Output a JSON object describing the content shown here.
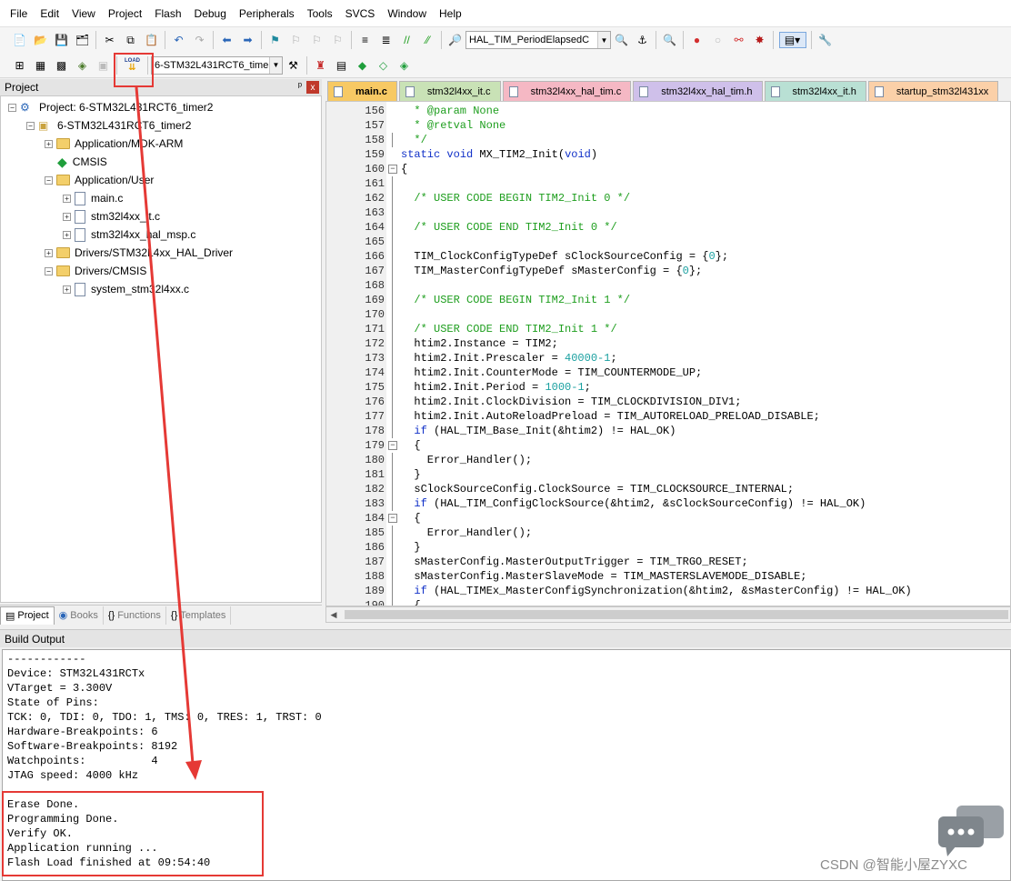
{
  "menu": [
    "File",
    "Edit",
    "View",
    "Project",
    "Flash",
    "Debug",
    "Peripherals",
    "Tools",
    "SVCS",
    "Window",
    "Help"
  ],
  "toolbar1": {
    "function_combo": "HAL_TIM_PeriodElapsedC"
  },
  "toolbar2": {
    "load_label": "LOAD",
    "target_combo": "6-STM32L431RCT6_timer."
  },
  "project_panel": {
    "title": "Project",
    "pin": "ᵖ",
    "close": "x",
    "tree": [
      {
        "label": "Project: 6-STM32L431RCT6_timer2"
      },
      {
        "label": "6-STM32L431RCT6_timer2"
      },
      {
        "label": "Application/MDK-ARM"
      },
      {
        "label": "CMSIS"
      },
      {
        "label": "Application/User"
      },
      {
        "label": "main.c"
      },
      {
        "label": "stm32l4xx_it.c"
      },
      {
        "label": "stm32l4xx_hal_msp.c"
      },
      {
        "label": "Drivers/STM32L4xx_HAL_Driver"
      },
      {
        "label": "Drivers/CMSIS"
      },
      {
        "label": "system_stm32l4xx.c"
      }
    ],
    "tabs": [
      {
        "label": "Project"
      },
      {
        "label": "Books"
      },
      {
        "label": "Functions"
      },
      {
        "label": "Templates"
      }
    ]
  },
  "editor_tabs": [
    {
      "label": "main.c"
    },
    {
      "label": "stm32l4xx_it.c"
    },
    {
      "label": "stm32l4xx_hal_tim.c"
    },
    {
      "label": "stm32l4xx_hal_tim.h"
    },
    {
      "label": "stm32l4xx_it.h"
    },
    {
      "label": "startup_stm32l431xx"
    }
  ],
  "code": {
    "lines": [
      {
        "n": "156",
        "t": "  * @param None"
      },
      {
        "n": "157",
        "t": "  * @retval None"
      },
      {
        "n": "158",
        "t": "  */"
      },
      {
        "n": "159",
        "t": "static void MX_TIM2_Init(void)"
      },
      {
        "n": "160",
        "t": "{"
      },
      {
        "n": "161",
        "t": ""
      },
      {
        "n": "162",
        "t": "  /* USER CODE BEGIN TIM2_Init 0 */"
      },
      {
        "n": "163",
        "t": ""
      },
      {
        "n": "164",
        "t": "  /* USER CODE END TIM2_Init 0 */"
      },
      {
        "n": "165",
        "t": ""
      },
      {
        "n": "166",
        "t": "  TIM_ClockConfigTypeDef sClockSourceConfig = {0};"
      },
      {
        "n": "167",
        "t": "  TIM_MasterConfigTypeDef sMasterConfig = {0};"
      },
      {
        "n": "168",
        "t": ""
      },
      {
        "n": "169",
        "t": "  /* USER CODE BEGIN TIM2_Init 1 */"
      },
      {
        "n": "170",
        "t": ""
      },
      {
        "n": "171",
        "t": "  /* USER CODE END TIM2_Init 1 */"
      },
      {
        "n": "172",
        "t": "  htim2.Instance = TIM2;"
      },
      {
        "n": "173",
        "t": "  htim2.Init.Prescaler = 40000-1;"
      },
      {
        "n": "174",
        "t": "  htim2.Init.CounterMode = TIM_COUNTERMODE_UP;"
      },
      {
        "n": "175",
        "t": "  htim2.Init.Period = 1000-1;"
      },
      {
        "n": "176",
        "t": "  htim2.Init.ClockDivision = TIM_CLOCKDIVISION_DIV1;"
      },
      {
        "n": "177",
        "t": "  htim2.Init.AutoReloadPreload = TIM_AUTORELOAD_PRELOAD_DISABLE;"
      },
      {
        "n": "178",
        "t": "  if (HAL_TIM_Base_Init(&htim2) != HAL_OK)"
      },
      {
        "n": "179",
        "t": "  {"
      },
      {
        "n": "180",
        "t": "    Error_Handler();"
      },
      {
        "n": "181",
        "t": "  }"
      },
      {
        "n": "182",
        "t": "  sClockSourceConfig.ClockSource = TIM_CLOCKSOURCE_INTERNAL;"
      },
      {
        "n": "183",
        "t": "  if (HAL_TIM_ConfigClockSource(&htim2, &sClockSourceConfig) != HAL_OK)"
      },
      {
        "n": "184",
        "t": "  {"
      },
      {
        "n": "185",
        "t": "    Error_Handler();"
      },
      {
        "n": "186",
        "t": "  }"
      },
      {
        "n": "187",
        "t": "  sMasterConfig.MasterOutputTrigger = TIM_TRGO_RESET;"
      },
      {
        "n": "188",
        "t": "  sMasterConfig.MasterSlaveMode = TIM_MASTERSLAVEMODE_DISABLE;"
      },
      {
        "n": "189",
        "t": "  if (HAL_TIMEx_MasterConfigSynchronization(&htim2, &sMasterConfig) != HAL_OK)"
      },
      {
        "n": "190",
        "t": "  {"
      }
    ]
  },
  "build_output": {
    "title": "Build Output",
    "lines": [
      "------------",
      "Device: STM32L431RCTx",
      "VTarget = 3.300V",
      "State of Pins:",
      "TCK: 0, TDI: 0, TDO: 1, TMS: 0, TRES: 1, TRST: 0",
      "Hardware-Breakpoints: 6",
      "Software-Breakpoints: 8192",
      "Watchpoints:          4",
      "JTAG speed: 4000 kHz",
      "",
      "Erase Done.",
      "Programming Done.",
      "Verify OK.",
      "Application running ...",
      "Flash Load finished at 09:54:40"
    ]
  },
  "watermark": "CSDN @智能小屋ZYXC",
  "colors": {
    "annotation": "#e53935",
    "keyword": "#1030c8",
    "comment": "#1e9e1e",
    "number": "#1aa0a0"
  }
}
